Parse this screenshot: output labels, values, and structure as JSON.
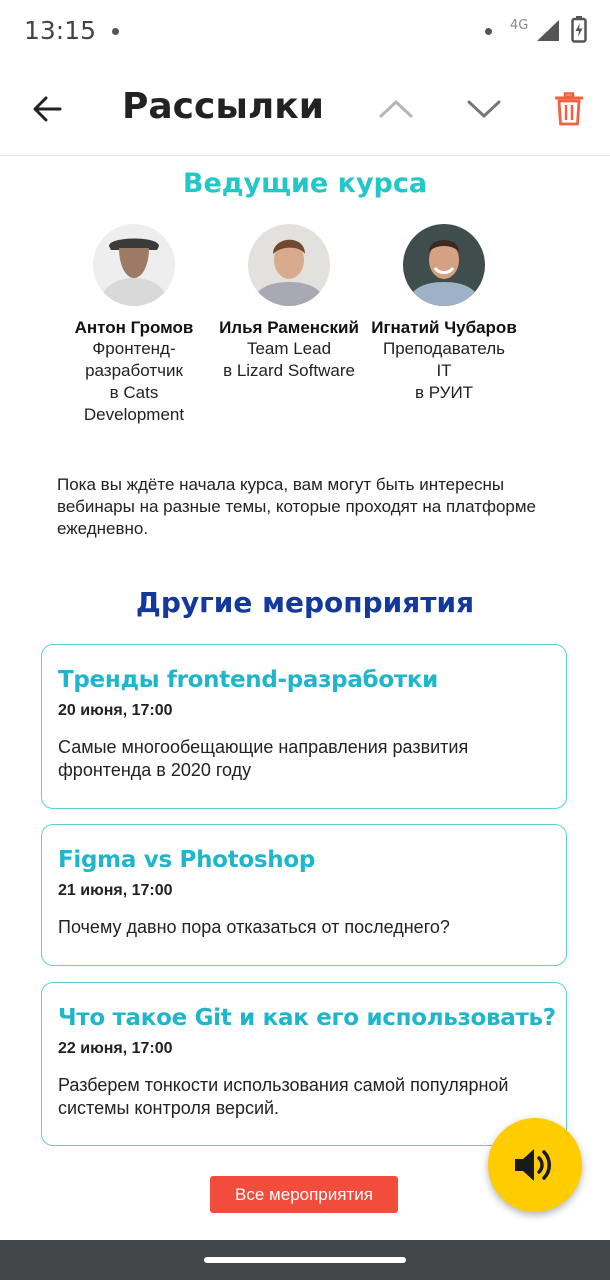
{
  "status_bar": {
    "time": "13:15",
    "network": "4G",
    "icons": [
      "notification-dot-icon",
      "signal-icon",
      "battery-charging-icon"
    ]
  },
  "app_bar": {
    "title": "Рассылки",
    "icons": [
      "back-arrow-icon",
      "chevron-up-icon",
      "chevron-down-icon",
      "trash-icon"
    ],
    "colors": {
      "trash": "#f2603f",
      "chevrons": "#b5b5b5"
    }
  },
  "hosts": {
    "title": "Ведущие курса",
    "items": [
      {
        "name": "Антон Громов",
        "role": "Фронтенд-\nразработчик\nв Cats\nDevelopment"
      },
      {
        "name": "Илья Раменский",
        "role": "Team Lead\nв Lizard Software"
      },
      {
        "name": "Игнатий Чубаров",
        "role": "Преподаватель\nIT\nв РУИТ"
      }
    ]
  },
  "intro_text": "Пока вы ждёте начала курса, вам могут быть интересны вебинары на разные темы, которые проходят на платформе ежедневно.",
  "events": {
    "title": "Другие мероприятия",
    "items": [
      {
        "title": "Тренды frontend-разработки",
        "date": "20 июня, 17:00",
        "description": "Самые многообещающие направления развития фронтенда в 2020 году"
      },
      {
        "title": "Figma vs Photoshop",
        "date": "21 июня, 17:00",
        "description": "Почему давно пора отказаться от последнего?"
      },
      {
        "title": "Что такое Git и как его использовать?",
        "date": "22 июня, 17:00",
        "description": "Разберем тонкости использования самой популярной системы контроля версий."
      }
    ],
    "all_button": "Все мероприятия"
  },
  "fab": {
    "icon": "speaker-icon",
    "color": "#ffcc00"
  },
  "colors": {
    "accent_teal": "#22c7c7",
    "event_title": "#1fb6cc",
    "events_heading": "#12399b",
    "button_red": "#f24c3c"
  }
}
